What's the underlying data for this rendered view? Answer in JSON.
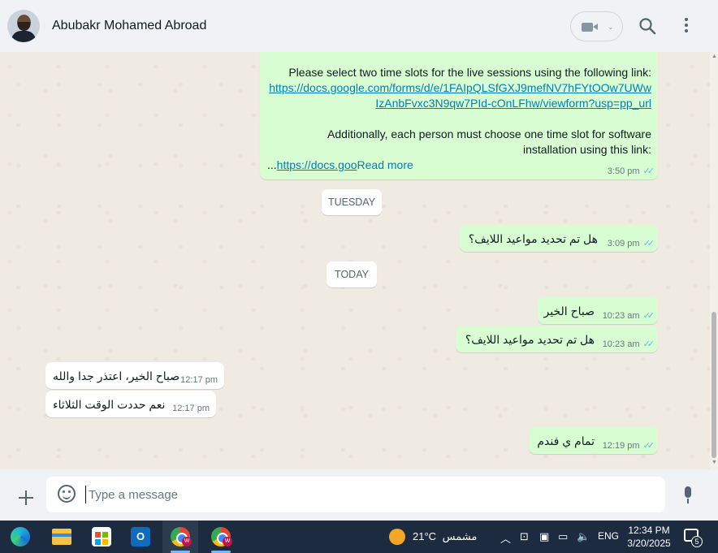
{
  "header": {
    "contact_name": "Abubakr Mohamed Abroad"
  },
  "messages": {
    "long": {
      "line1": "Please select two time slots for the live sessions using the following link:",
      "link1_a": "https://docs.google.com/forms/d/e/1FAIpQLSfGXJ9mefNV7hFYtOOw7UWw",
      "link1_b": "IzAnbFvxc3N9qw7PId-cOnLFhw/viewform?usp=pp_url",
      "line2": "Additionally, each person must choose one time slot for software",
      "line3": "installation using this link:",
      "link2": "https://docs.goo",
      "ellipsis": "...",
      "read_more": "Read more",
      "time": "3:50 pm"
    },
    "day1": "TUESDAY",
    "msg2": {
      "text": "هل تم تحديد مواعيد اللايف؟",
      "time": "3:09 pm"
    },
    "day2": "TODAY",
    "msg3": {
      "text": "صباح الخير",
      "time": "10:23 am"
    },
    "msg4": {
      "text": "هل تم تحديد مواعيد اللايف؟",
      "time": "10:23 am"
    },
    "msg5": {
      "text": "صباح الخير، اعتذر جدا والله",
      "time": "12:17 pm"
    },
    "msg6": {
      "text": "نعم حددت الوقت الثلاثاء",
      "time": "12:17 pm"
    },
    "msg7": {
      "text": "تمام ي فندم",
      "time": "12:19 pm"
    },
    "tick_glyph": "✓✓"
  },
  "composer": {
    "placeholder": "Type a message"
  },
  "taskbar": {
    "temperature": "21°C",
    "weather_text": "مشمس",
    "language": "ENG",
    "time": "12:34 PM",
    "date": "3/20/2025",
    "notification_count": "5",
    "outlook_letter": "O",
    "chrome_badge": "W"
  },
  "colors": {
    "outgoing_bubble": "#d9fdd3",
    "incoming_bubble": "#ffffff",
    "link": "#027eb5",
    "read_ticks": "#53bdeb",
    "chat_background": "#efeae2",
    "taskbar": "#1c2b40"
  }
}
